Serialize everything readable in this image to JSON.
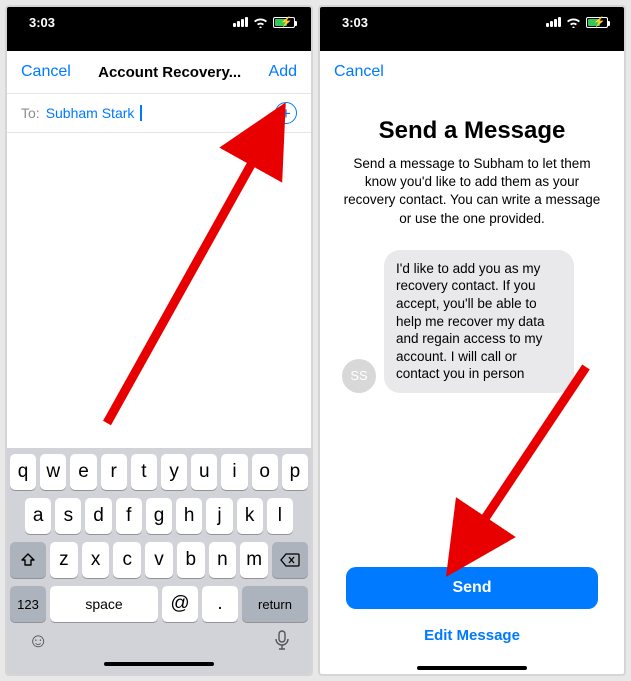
{
  "status": {
    "time": "3:03"
  },
  "left": {
    "nav": {
      "cancel": "Cancel",
      "title": "Account Recovery...",
      "add": "Add"
    },
    "to": {
      "label": "To:",
      "name": "Subham Stark"
    },
    "keys": {
      "row1": [
        "q",
        "w",
        "e",
        "r",
        "t",
        "y",
        "u",
        "i",
        "o",
        "p"
      ],
      "row2": [
        "a",
        "s",
        "d",
        "f",
        "g",
        "h",
        "j",
        "k",
        "l"
      ],
      "row3": [
        "z",
        "x",
        "c",
        "v",
        "b",
        "n",
        "m"
      ],
      "k123": "123",
      "at": "@",
      "dot": ".",
      "space": "space",
      "ret": "return"
    }
  },
  "right": {
    "nav": {
      "cancel": "Cancel"
    },
    "title": "Send a Message",
    "subtitle": "Send a message to Subham to let them know you'd like to add them as your recovery contact. You can write a message or use the one provided.",
    "avatar": "SS",
    "message": "I'd like to add you as my recovery contact. If you accept, you'll be able to help me recover my data and regain access to my account. I will call or contact you in person",
    "send": "Send",
    "edit": "Edit Message"
  }
}
